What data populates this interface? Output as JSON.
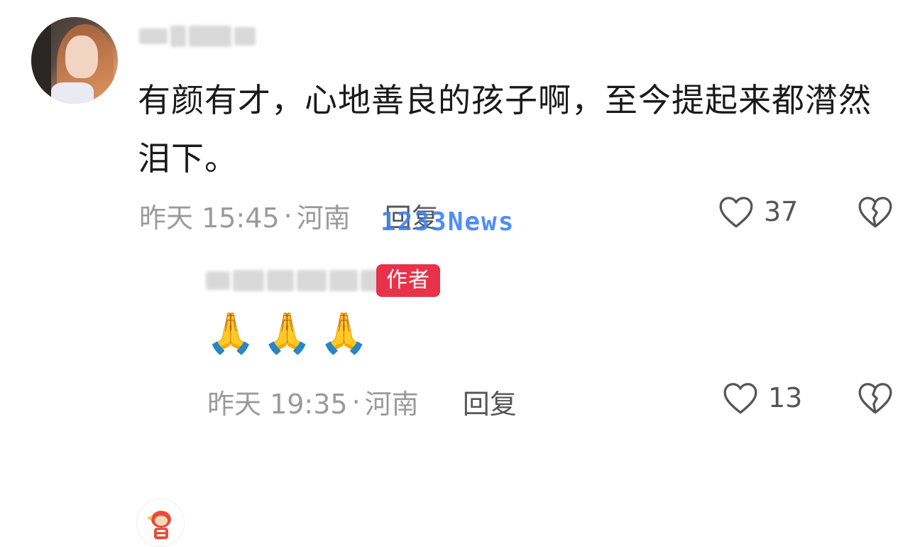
{
  "comment": {
    "text": "有颜有才，心地善良的孩子啊，至今提起来都潸然泪下。",
    "time": "昨天 15:45",
    "location": "河南",
    "reply_label": "回复",
    "likes": "37"
  },
  "watermark": "1233News",
  "reply": {
    "badge": "作者",
    "emojis": "🙏🙏🙏",
    "time": "昨天 19:35",
    "location": "河南",
    "reply_label": "回复",
    "likes": "13"
  },
  "icons": {
    "like": "heart-outline-icon",
    "dislike": "broken-heart-icon"
  },
  "colors": {
    "author_badge": "#e8324a",
    "watermark": "#3b82f6",
    "meta_text": "#9a9a9a"
  }
}
